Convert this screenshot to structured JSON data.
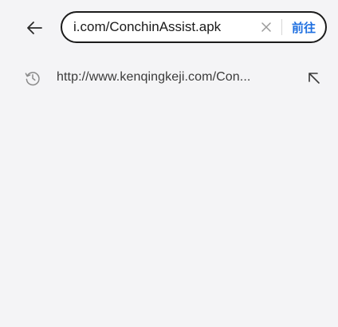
{
  "address_bar": {
    "url_value": "i.com/ConchinAssist.apk",
    "go_label": "前往"
  },
  "suggestions": [
    {
      "text": "http://www.kenqingkeji.com/Con..."
    }
  ],
  "icons": {
    "back": "arrow-left-icon",
    "clear": "close-icon",
    "history": "history-clock-icon",
    "fill": "arrow-up-left-icon"
  },
  "colors": {
    "background": "#f4f4f6",
    "accent": "#1e6fe0",
    "text": "#1a1a1a"
  }
}
